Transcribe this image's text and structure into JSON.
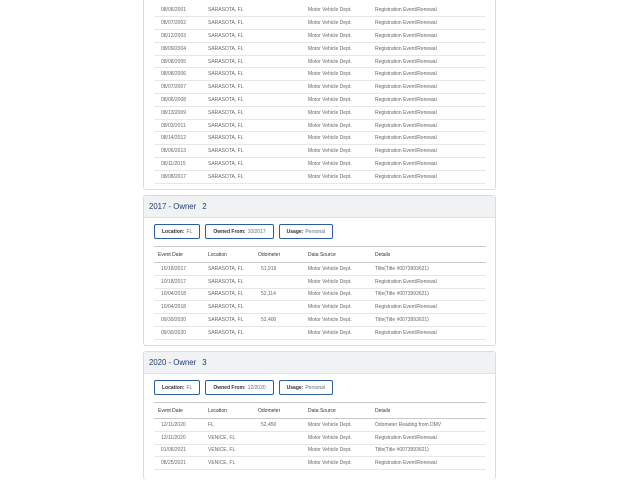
{
  "colors": {
    "header_bg": "#f1f2f3",
    "title_text": "#1f3e75",
    "tag_border": "#2b5fa0"
  },
  "history_table": {
    "rows": [
      {
        "date": "08/06/2001",
        "location": "SARASOTA, FL",
        "odometer": "",
        "source": "Motor Vehicle Dept.",
        "details": "Registration Event/Renewal"
      },
      {
        "date": "08/07/2002",
        "location": "SARASOTA, FL",
        "odometer": "",
        "source": "Motor Vehicle Dept.",
        "details": "Registration Event/Renewal"
      },
      {
        "date": "08/12/2003",
        "location": "SARASOTA, FL",
        "odometer": "",
        "source": "Motor Vehicle Dept.",
        "details": "Registration Event/Renewal"
      },
      {
        "date": "08/09/2004",
        "location": "SARASOTA, FL",
        "odometer": "",
        "source": "Motor Vehicle Dept.",
        "details": "Registration Event/Renewal"
      },
      {
        "date": "08/08/2005",
        "location": "SARASOTA, FL",
        "odometer": "",
        "source": "Motor Vehicle Dept.",
        "details": "Registration Event/Renewal"
      },
      {
        "date": "08/08/2006",
        "location": "SARASOTA, FL",
        "odometer": "",
        "source": "Motor Vehicle Dept.",
        "details": "Registration Event/Renewal"
      },
      {
        "date": "08/07/2007",
        "location": "SARASOTA, FL",
        "odometer": "",
        "source": "Motor Vehicle Dept.",
        "details": "Registration Event/Renewal"
      },
      {
        "date": "08/06/2008",
        "location": "SARASOTA, FL",
        "odometer": "",
        "source": "Motor Vehicle Dept.",
        "details": "Registration Event/Renewal"
      },
      {
        "date": "08/13/2009",
        "location": "SARASOTA, FL",
        "odometer": "",
        "source": "Motor Vehicle Dept.",
        "details": "Registration Event/Renewal"
      },
      {
        "date": "08/03/2011",
        "location": "SARASOTA, FL",
        "odometer": "",
        "source": "Motor Vehicle Dept.",
        "details": "Registration Event/Renewal"
      },
      {
        "date": "08/14/2012",
        "location": "SARASOTA, FL",
        "odometer": "",
        "source": "Motor Vehicle Dept.",
        "details": "Registration Event/Renewal"
      },
      {
        "date": "08/06/2013",
        "location": "SARASOTA, FL",
        "odometer": "",
        "source": "Motor Vehicle Dept.",
        "details": "Registration Event/Renewal"
      },
      {
        "date": "08/11/2015",
        "location": "SARASOTA, FL",
        "odometer": "",
        "source": "Motor Vehicle Dept.",
        "details": "Registration Event/Renewal"
      },
      {
        "date": "08/08/2017",
        "location": "SARASOTA, FL",
        "odometer": "",
        "source": "Motor Vehicle Dept.",
        "details": "Registration Event/Renewal"
      }
    ]
  },
  "owners": [
    {
      "title": "2017 - Owner",
      "number": "2",
      "tags": [
        {
          "label": "Location:",
          "value": "FL"
        },
        {
          "label": "Owned From:",
          "value": "10/2017"
        },
        {
          "label": "Usage:",
          "value": "Personal"
        }
      ],
      "columns": [
        "Event Date",
        "Location",
        "Odometer",
        "Data Source",
        "Details"
      ],
      "rows": [
        {
          "date": "10/18/2017",
          "location": "SARASOTA, FL",
          "odometer": "51,919",
          "source": "Motor Vehicle Dept.",
          "details": "Title(Title #0073993621)"
        },
        {
          "date": "10/18/2017",
          "location": "SARASOTA, FL",
          "odometer": "",
          "source": "Motor Vehicle Dept.",
          "details": "Registration Event/Renewal"
        },
        {
          "date": "10/04/2018",
          "location": "SARASOTA, FL",
          "odometer": "52,114",
          "source": "Motor Vehicle Dept.",
          "details": "Title(Title #0073993621)"
        },
        {
          "date": "10/04/2018",
          "location": "SARASOTA, FL",
          "odometer": "",
          "source": "Motor Vehicle Dept.",
          "details": "Registration Event/Renewal"
        },
        {
          "date": "09/30/2020",
          "location": "SARASOTA, FL",
          "odometer": "52,400",
          "source": "Motor Vehicle Dept.",
          "details": "Title(Title #0073993621)"
        },
        {
          "date": "09/30/2020",
          "location": "SARASOTA, FL",
          "odometer": "",
          "source": "Motor Vehicle Dept.",
          "details": "Registration Event/Renewal"
        }
      ]
    },
    {
      "title": "2020 - Owner",
      "number": "3",
      "tags": [
        {
          "label": "Location:",
          "value": "FL"
        },
        {
          "label": "Owned From:",
          "value": "12/2020"
        },
        {
          "label": "Usage:",
          "value": "Personal"
        }
      ],
      "columns": [
        "Event Date",
        "Location",
        "Odometer",
        "Data Source",
        "Details"
      ],
      "rows": [
        {
          "date": "12/11/2020",
          "location": "FL",
          "odometer": "52,450",
          "source": "Motor Vehicle Dept.",
          "details": "Odometer Reading from DMV"
        },
        {
          "date": "12/11/2020",
          "location": "VENICE, FL",
          "odometer": "",
          "source": "Motor Vehicle Dept.",
          "details": "Registration Event/Renewal"
        },
        {
          "date": "01/06/2021",
          "location": "VENICE, FL",
          "odometer": "",
          "source": "Motor Vehicle Dept.",
          "details": "Title(Title #0073993621)"
        },
        {
          "date": "08/25/2021",
          "location": "VENICE, FL",
          "odometer": "",
          "source": "Motor Vehicle Dept.",
          "details": "Registration Event/Renewal"
        }
      ]
    }
  ]
}
